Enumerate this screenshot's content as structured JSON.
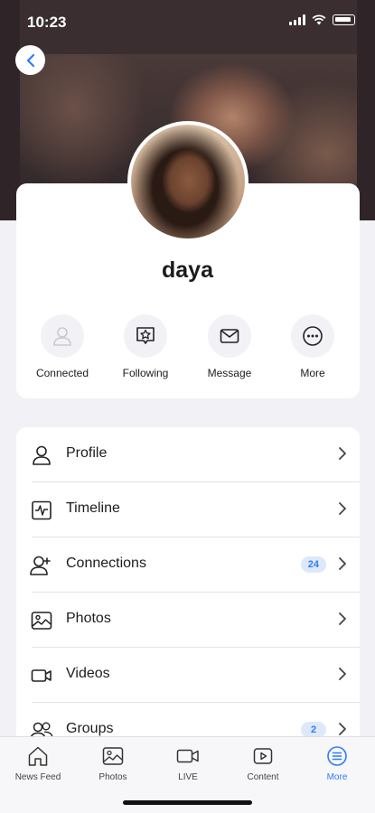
{
  "status": {
    "time": "10:23"
  },
  "profile": {
    "name": "daya"
  },
  "actions": [
    {
      "label": "Connected",
      "icon": "person-icon"
    },
    {
      "label": "Following",
      "icon": "star-bubble-icon"
    },
    {
      "label": "Message",
      "icon": "envelope-icon"
    },
    {
      "label": "More",
      "icon": "ellipsis-icon"
    }
  ],
  "menu": [
    {
      "label": "Profile",
      "icon": "person-icon",
      "badge": ""
    },
    {
      "label": "Timeline",
      "icon": "activity-icon",
      "badge": ""
    },
    {
      "label": "Connections",
      "icon": "add-person-icon",
      "badge": "24"
    },
    {
      "label": "Photos",
      "icon": "image-icon",
      "badge": ""
    },
    {
      "label": "Videos",
      "icon": "video-icon",
      "badge": ""
    },
    {
      "label": "Groups",
      "icon": "people-icon",
      "badge": "2"
    }
  ],
  "tabs": [
    {
      "label": "News Feed",
      "icon": "home-icon"
    },
    {
      "label": "Photos",
      "icon": "photos-icon"
    },
    {
      "label": "LIVE",
      "icon": "camera-icon"
    },
    {
      "label": "Content",
      "icon": "play-icon"
    },
    {
      "label": "More",
      "icon": "menu-icon",
      "active": true
    }
  ],
  "colors": {
    "accent": "#2d7cf6",
    "badge_bg": "#dde9fb"
  }
}
